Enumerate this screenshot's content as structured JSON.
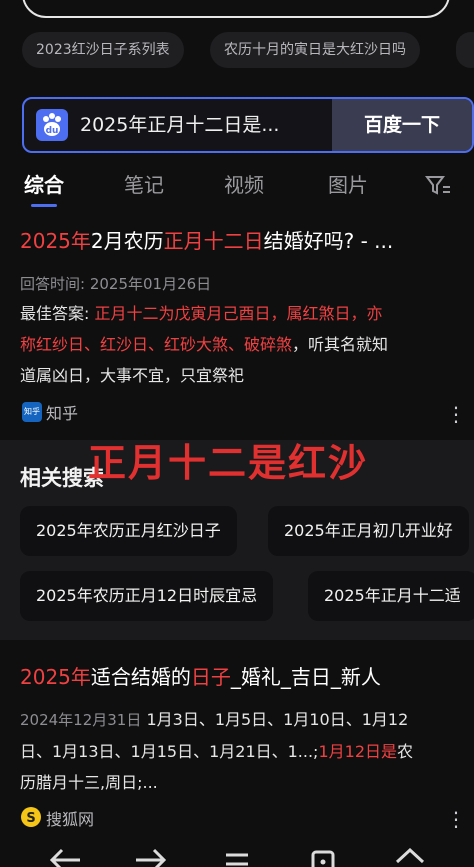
{
  "suggestions": [
    "2023红沙日子系列表",
    "农历十月的寅日是大红沙日吗"
  ],
  "search": {
    "query": "2025年正月十二日是...",
    "button": "百度一下"
  },
  "tabs": [
    "综合",
    "笔记",
    "视频",
    "图片"
  ],
  "result1": {
    "title_a": "2025年",
    "title_b": "2月农历",
    "title_c": "正月十二日",
    "title_d": "结婚好吗? - ...",
    "answer_time": "回答时间: 2025年01月26日",
    "best_label": "最佳答案:",
    "best_red_1": "正月十二为戊寅月己酉日，属红煞日，亦",
    "best_red_2": "称红纱日、红沙日、红砂大煞、破碎煞",
    "best_rest_2": "，听其名就知",
    "best_line_3": "道属凶日，大事不宜，只宜祭祀",
    "source": "知乎",
    "source_icon_text": "知乎"
  },
  "overlay_text": "正月十二是红沙",
  "related": {
    "heading": "相关搜索",
    "items": [
      "2025年农历正月红沙日子",
      "2025年正月初几开业好",
      "2025年农历正月12日时辰宜忌",
      "2025年正月十二适"
    ]
  },
  "result2": {
    "title_a": "2025年",
    "title_b": "适合结婚的",
    "title_c": "日子",
    "title_d": "_婚礼_吉日_新人",
    "date": "2024年12月31日",
    "line1": "1月3日、1月5日、1月10日、1月12",
    "line2_a": "日、1月13日、1月15日、1月21日、1...;",
    "line2_b": "1月12日是",
    "line2_c": "农",
    "line3": "历腊月十三,周日;...",
    "source": "搜狐网"
  },
  "colors": {
    "accent": "#4e6ef2",
    "highlight": "#f04142"
  }
}
